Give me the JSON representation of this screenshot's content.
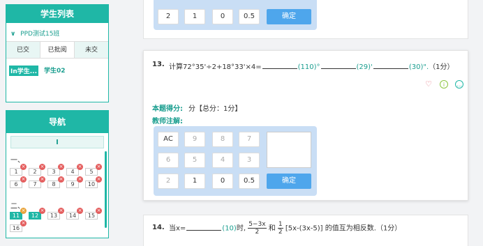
{
  "students_panel": {
    "title": "学生列表",
    "class_name": "PPD测试15班",
    "tabs": [
      "已交",
      "已批阅",
      "未交"
    ],
    "students": [
      "In学生...",
      "学生02"
    ]
  },
  "nav_panel": {
    "title": "导航",
    "part_label": "I",
    "section1": "一、",
    "section2": "二、",
    "section1_questions": [
      "1",
      "2",
      "3",
      "4",
      "5",
      "6",
      "7",
      "8",
      "9",
      "10"
    ],
    "section2_questions": [
      "11",
      "12",
      "13",
      "14",
      "15",
      "16"
    ]
  },
  "keypad_top": {
    "keys": [
      "2",
      "1",
      "0",
      "0.5"
    ],
    "confirm": "确定"
  },
  "question13": {
    "number": "13.",
    "text_prefix": "计算72°35'÷2+18°33'×4=",
    "ans1": "(110)°",
    "ans2": "(29)'",
    "ans3": "(30)\".",
    "points": "（1分）",
    "score_label": "本题得分:",
    "score_value": "分【总分：1分】",
    "comment_label": "教师注解:",
    "keypad": {
      "row1": [
        "AC",
        "9",
        "8",
        "7"
      ],
      "row2": [
        "6",
        "5",
        "4",
        "3"
      ],
      "row3": [
        "2",
        "1",
        "0",
        "0.5"
      ],
      "confirm": "确定"
    }
  },
  "question14": {
    "number": "14.",
    "prefix": "当x=",
    "ans": "(10)",
    "mid": "时,",
    "frac1_num": "5−3x",
    "frac1_den": "2",
    "and": "和",
    "frac2_num": "1",
    "frac2_den": "2",
    "bracket": "[5x-(3x-5)]",
    "suffix": "的值互为相反数.（1分）"
  },
  "colors": {
    "accent": "#1fb7a6",
    "confirm": "#4ea6ec",
    "wrong": "#e45d5d"
  }
}
